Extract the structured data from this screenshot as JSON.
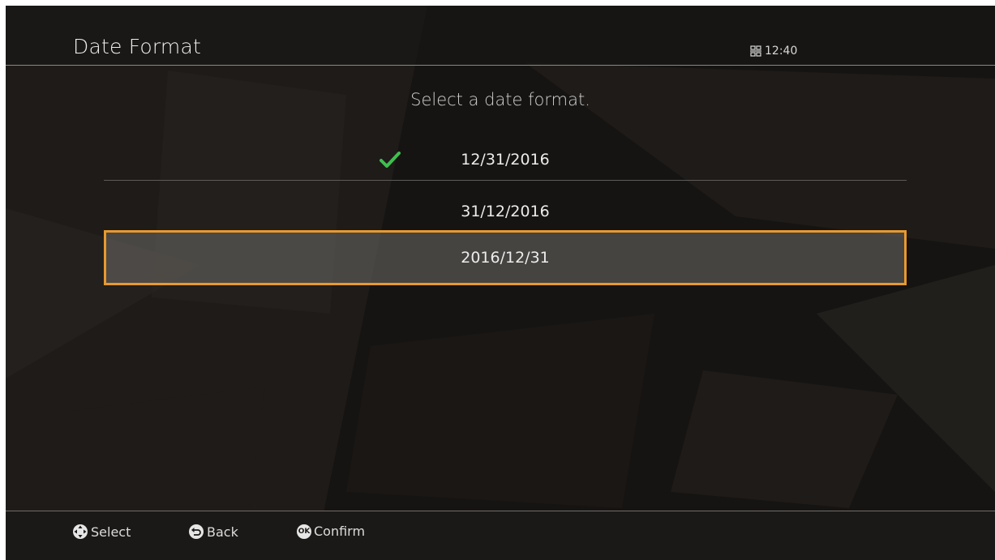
{
  "header": {
    "title": "Date Format",
    "time": "12:40",
    "network_icon": "network-icon"
  },
  "prompt": "Select a date format.",
  "options": [
    {
      "label": "12/31/2016",
      "checked": true,
      "focused": false
    },
    {
      "label": "31/12/2016",
      "checked": false,
      "focused": false
    },
    {
      "label": "2016/12/31",
      "checked": false,
      "focused": true
    }
  ],
  "footer": {
    "select_label": "Select",
    "back_label": "Back",
    "confirm_label": "Confirm",
    "ok_badge": "OK"
  },
  "colors": {
    "focus_border": "#e8992f",
    "check": "#3fbf4f",
    "background": "#161412"
  }
}
